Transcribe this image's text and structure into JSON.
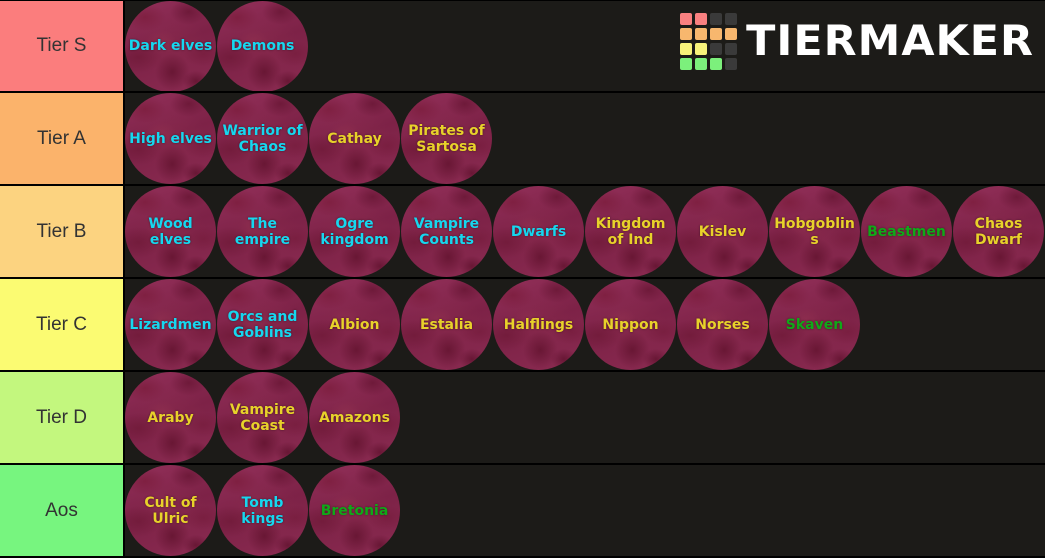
{
  "brand": {
    "name": "TIERMAKER",
    "logo_icon": "tiermaker-grid-icon",
    "grid_colors": [
      "#f98080",
      "#f98080",
      "#3a3a3a",
      "#3a3a3a",
      "#f7b76e",
      "#f7b76e",
      "#f7b76e",
      "#f7b76e",
      "#f7f27a",
      "#f7f27a",
      "#3a3a3a",
      "#3a3a3a",
      "#7cf07c",
      "#7cf07c",
      "#7cf07c",
      "#3a3a3a"
    ]
  },
  "colors": {
    "background": "#1c1b18",
    "divider": "#000000",
    "label_text": "#333333",
    "item_base": "#8b2b52",
    "text_cyan": "#16d7ef",
    "text_yellow": "#e8d22a",
    "text_green": "#10a818"
  },
  "rows": [
    {
      "label": "Tier S",
      "color": "#fb7d7d",
      "items": [
        {
          "label": "Dark elves",
          "text_color": "#16d7ef"
        },
        {
          "label": "Demons",
          "text_color": "#16d7ef"
        }
      ]
    },
    {
      "label": "Tier A",
      "color": "#fbb36b",
      "items": [
        {
          "label": "High elves",
          "text_color": "#16d7ef"
        },
        {
          "label": "Warrior of Chaos",
          "text_color": "#16d7ef"
        },
        {
          "label": "Cathay",
          "text_color": "#e8d22a"
        },
        {
          "label": "Pirates of Sartosa",
          "text_color": "#e8d22a"
        }
      ]
    },
    {
      "label": "Tier B",
      "color": "#fcd380",
      "items": [
        {
          "label": "Wood elves",
          "text_color": "#16d7ef"
        },
        {
          "label": "The empire",
          "text_color": "#16d7ef"
        },
        {
          "label": "Ogre kingdom",
          "text_color": "#16d7ef"
        },
        {
          "label": "Vampire Counts",
          "text_color": "#16d7ef"
        },
        {
          "label": "Dwarfs",
          "text_color": "#16d7ef"
        },
        {
          "label": "Kingdom of Ind",
          "text_color": "#e8d22a"
        },
        {
          "label": "Kislev",
          "text_color": "#e8d22a"
        },
        {
          "label": "Hobgoblins",
          "text_color": "#e8d22a"
        },
        {
          "label": "Beastmen",
          "text_color": "#10a818"
        },
        {
          "label": "Chaos Dwarf",
          "text_color": "#e8d22a"
        }
      ]
    },
    {
      "label": "Tier C",
      "color": "#fbfb72",
      "items": [
        {
          "label": "Lizardmen",
          "text_color": "#16d7ef"
        },
        {
          "label": "Orcs and Goblins",
          "text_color": "#16d7ef"
        },
        {
          "label": "Albion",
          "text_color": "#e8d22a"
        },
        {
          "label": "Estalia",
          "text_color": "#e8d22a"
        },
        {
          "label": "Halflings",
          "text_color": "#e8d22a"
        },
        {
          "label": "Nippon",
          "text_color": "#e8d22a"
        },
        {
          "label": "Norses",
          "text_color": "#e8d22a"
        },
        {
          "label": "Skaven",
          "text_color": "#10a818"
        }
      ]
    },
    {
      "label": "Tier D",
      "color": "#c3f77e",
      "items": [
        {
          "label": "Araby",
          "text_color": "#e8d22a"
        },
        {
          "label": "Vampire Coast",
          "text_color": "#e8d22a"
        },
        {
          "label": "Amazons",
          "text_color": "#e8d22a"
        }
      ]
    },
    {
      "label": "Aos",
      "color": "#77f57f",
      "items": [
        {
          "label": "Cult of Ulric",
          "text_color": "#e8d22a"
        },
        {
          "label": "Tomb kings",
          "text_color": "#16d7ef"
        },
        {
          "label": "Bretonia",
          "text_color": "#10a818"
        }
      ]
    }
  ]
}
